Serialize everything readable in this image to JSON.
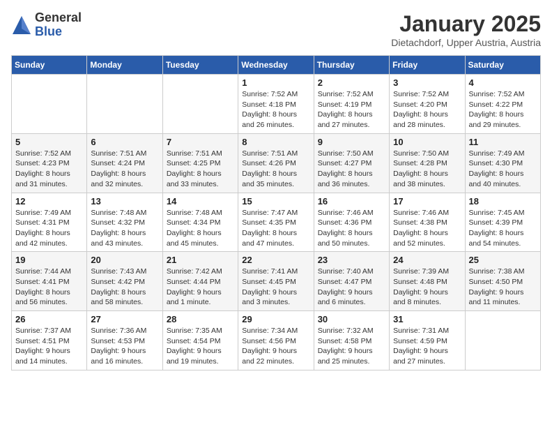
{
  "logo": {
    "general": "General",
    "blue": "Blue"
  },
  "title": {
    "month_year": "January 2025",
    "location": "Dietachdorf, Upper Austria, Austria"
  },
  "weekdays": [
    "Sunday",
    "Monday",
    "Tuesday",
    "Wednesday",
    "Thursday",
    "Friday",
    "Saturday"
  ],
  "weeks": [
    [
      {
        "day": "",
        "info": ""
      },
      {
        "day": "",
        "info": ""
      },
      {
        "day": "",
        "info": ""
      },
      {
        "day": "1",
        "info": "Sunrise: 7:52 AM\nSunset: 4:18 PM\nDaylight: 8 hours and 26 minutes."
      },
      {
        "day": "2",
        "info": "Sunrise: 7:52 AM\nSunset: 4:19 PM\nDaylight: 8 hours and 27 minutes."
      },
      {
        "day": "3",
        "info": "Sunrise: 7:52 AM\nSunset: 4:20 PM\nDaylight: 8 hours and 28 minutes."
      },
      {
        "day": "4",
        "info": "Sunrise: 7:52 AM\nSunset: 4:22 PM\nDaylight: 8 hours and 29 minutes."
      }
    ],
    [
      {
        "day": "5",
        "info": "Sunrise: 7:52 AM\nSunset: 4:23 PM\nDaylight: 8 hours and 31 minutes."
      },
      {
        "day": "6",
        "info": "Sunrise: 7:51 AM\nSunset: 4:24 PM\nDaylight: 8 hours and 32 minutes."
      },
      {
        "day": "7",
        "info": "Sunrise: 7:51 AM\nSunset: 4:25 PM\nDaylight: 8 hours and 33 minutes."
      },
      {
        "day": "8",
        "info": "Sunrise: 7:51 AM\nSunset: 4:26 PM\nDaylight: 8 hours and 35 minutes."
      },
      {
        "day": "9",
        "info": "Sunrise: 7:50 AM\nSunset: 4:27 PM\nDaylight: 8 hours and 36 minutes."
      },
      {
        "day": "10",
        "info": "Sunrise: 7:50 AM\nSunset: 4:28 PM\nDaylight: 8 hours and 38 minutes."
      },
      {
        "day": "11",
        "info": "Sunrise: 7:49 AM\nSunset: 4:30 PM\nDaylight: 8 hours and 40 minutes."
      }
    ],
    [
      {
        "day": "12",
        "info": "Sunrise: 7:49 AM\nSunset: 4:31 PM\nDaylight: 8 hours and 42 minutes."
      },
      {
        "day": "13",
        "info": "Sunrise: 7:48 AM\nSunset: 4:32 PM\nDaylight: 8 hours and 43 minutes."
      },
      {
        "day": "14",
        "info": "Sunrise: 7:48 AM\nSunset: 4:34 PM\nDaylight: 8 hours and 45 minutes."
      },
      {
        "day": "15",
        "info": "Sunrise: 7:47 AM\nSunset: 4:35 PM\nDaylight: 8 hours and 47 minutes."
      },
      {
        "day": "16",
        "info": "Sunrise: 7:46 AM\nSunset: 4:36 PM\nDaylight: 8 hours and 50 minutes."
      },
      {
        "day": "17",
        "info": "Sunrise: 7:46 AM\nSunset: 4:38 PM\nDaylight: 8 hours and 52 minutes."
      },
      {
        "day": "18",
        "info": "Sunrise: 7:45 AM\nSunset: 4:39 PM\nDaylight: 8 hours and 54 minutes."
      }
    ],
    [
      {
        "day": "19",
        "info": "Sunrise: 7:44 AM\nSunset: 4:41 PM\nDaylight: 8 hours and 56 minutes."
      },
      {
        "day": "20",
        "info": "Sunrise: 7:43 AM\nSunset: 4:42 PM\nDaylight: 8 hours and 58 minutes."
      },
      {
        "day": "21",
        "info": "Sunrise: 7:42 AM\nSunset: 4:44 PM\nDaylight: 9 hours and 1 minute."
      },
      {
        "day": "22",
        "info": "Sunrise: 7:41 AM\nSunset: 4:45 PM\nDaylight: 9 hours and 3 minutes."
      },
      {
        "day": "23",
        "info": "Sunrise: 7:40 AM\nSunset: 4:47 PM\nDaylight: 9 hours and 6 minutes."
      },
      {
        "day": "24",
        "info": "Sunrise: 7:39 AM\nSunset: 4:48 PM\nDaylight: 9 hours and 8 minutes."
      },
      {
        "day": "25",
        "info": "Sunrise: 7:38 AM\nSunset: 4:50 PM\nDaylight: 9 hours and 11 minutes."
      }
    ],
    [
      {
        "day": "26",
        "info": "Sunrise: 7:37 AM\nSunset: 4:51 PM\nDaylight: 9 hours and 14 minutes."
      },
      {
        "day": "27",
        "info": "Sunrise: 7:36 AM\nSunset: 4:53 PM\nDaylight: 9 hours and 16 minutes."
      },
      {
        "day": "28",
        "info": "Sunrise: 7:35 AM\nSunset: 4:54 PM\nDaylight: 9 hours and 19 minutes."
      },
      {
        "day": "29",
        "info": "Sunrise: 7:34 AM\nSunset: 4:56 PM\nDaylight: 9 hours and 22 minutes."
      },
      {
        "day": "30",
        "info": "Sunrise: 7:32 AM\nSunset: 4:58 PM\nDaylight: 9 hours and 25 minutes."
      },
      {
        "day": "31",
        "info": "Sunrise: 7:31 AM\nSunset: 4:59 PM\nDaylight: 9 hours and 27 minutes."
      },
      {
        "day": "",
        "info": ""
      }
    ]
  ]
}
